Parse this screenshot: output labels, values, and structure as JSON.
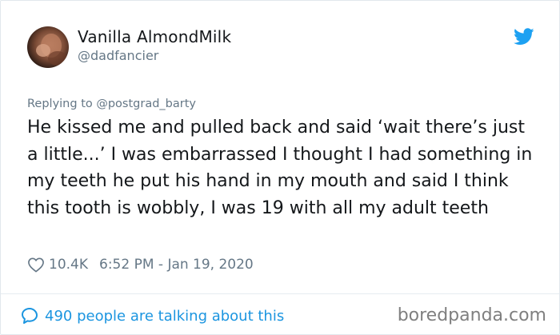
{
  "author": {
    "display_name": "Vanilla AlmondMilk",
    "handle": "@dadfancier"
  },
  "tweet": {
    "replying_to": "Replying to @postgrad_barty",
    "text": "He kissed me and pulled back and said ‘wait there’s just a little...’ I was embarrassed I thought I had something in my teeth he put his hand in my mouth and said I think this tooth is wobbly, I was 19 with all my adult teeth",
    "likes": "10.4K",
    "timestamp": "6:52 PM - Jan 19, 2020"
  },
  "footer": {
    "talking": "490 people are talking about this",
    "watermark": "boredpanda.com"
  },
  "icons": {
    "brand": "twitter-bird-icon",
    "like": "heart-icon",
    "conversation": "speech-bubble-icon"
  },
  "colors": {
    "twitter_blue": "#1da1f2",
    "link_blue": "#1b95e0",
    "secondary_text": "#657786",
    "primary_text": "#14171a"
  }
}
